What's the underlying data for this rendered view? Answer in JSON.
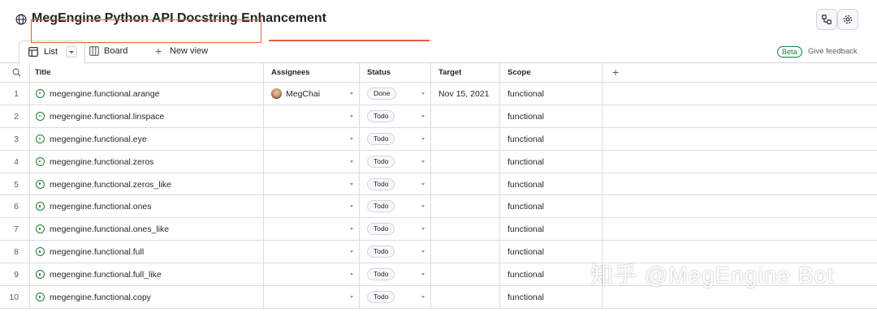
{
  "header": {
    "title": "MegEngine Python API Docstring Enhancement",
    "icons": [
      "globe-icon",
      "workflows-icon",
      "settings-icon"
    ]
  },
  "views": {
    "list_label": "List",
    "board_label": "Board",
    "new_view_label": "New view",
    "beta_label": "Beta",
    "feedback_label": "Give feedback"
  },
  "columns": [
    "Title",
    "Assignees",
    "Status",
    "Target",
    "Scope"
  ],
  "rows": [
    {
      "num": "1",
      "title": "megengine.functional.arange",
      "assignee": "MegChai",
      "status": "Done",
      "target": "Nov 15, 2021",
      "scope": "functional"
    },
    {
      "num": "2",
      "title": "megengine.functional.linspace",
      "assignee": "",
      "status": "Todo",
      "target": "",
      "scope": "functional"
    },
    {
      "num": "3",
      "title": "megengine.functional.eye",
      "assignee": "",
      "status": "Todo",
      "target": "",
      "scope": "functional"
    },
    {
      "num": "4",
      "title": "megengine.functional.zeros",
      "assignee": "",
      "status": "Todo",
      "target": "",
      "scope": "functional"
    },
    {
      "num": "5",
      "title": "megengine.functional.zeros_like",
      "assignee": "",
      "status": "Todo",
      "target": "",
      "scope": "functional"
    },
    {
      "num": "6",
      "title": "megengine.functional.ones",
      "assignee": "",
      "status": "Todo",
      "target": "",
      "scope": "functional"
    },
    {
      "num": "7",
      "title": "megengine.functional.ones_like",
      "assignee": "",
      "status": "Todo",
      "target": "",
      "scope": "functional"
    },
    {
      "num": "8",
      "title": "megengine.functional.full",
      "assignee": "",
      "status": "Todo",
      "target": "",
      "scope": "functional"
    },
    {
      "num": "9",
      "title": "megengine.functional.full_like",
      "assignee": "",
      "status": "Todo",
      "target": "",
      "scope": "functional"
    },
    {
      "num": "10",
      "title": "megengine.functional.copy",
      "assignee": "",
      "status": "Todo",
      "target": "",
      "scope": "functional"
    }
  ],
  "watermark": "知乎 @MegEngine Bot",
  "colors": {
    "accent": "#e4623d",
    "issue_open": "#1a7f37",
    "border": "#d0d7de"
  }
}
